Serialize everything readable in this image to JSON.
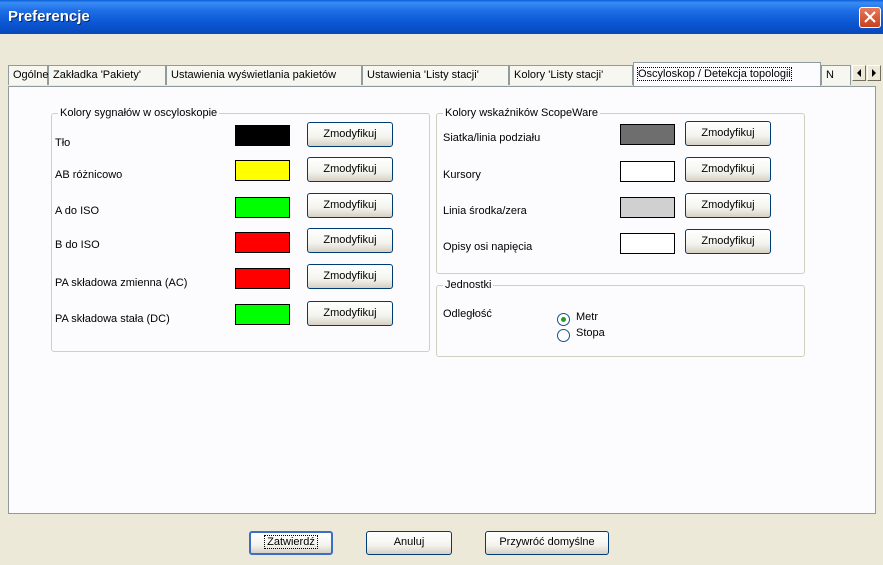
{
  "window": {
    "title": "Preferencje"
  },
  "tabs": [
    {
      "label": "Ogólne"
    },
    {
      "label": "Zakładka 'Pakiety'"
    },
    {
      "label": "Ustawienia wyświetlania pakietów"
    },
    {
      "label": "Ustawienia 'Listy stacji'"
    },
    {
      "label": "Kolory 'Listy stacji'"
    },
    {
      "label": "Oscyloskop / Detekcja topologii"
    },
    {
      "label": "N"
    }
  ],
  "active_tab": "Oscyloskop / Detekcja topologii",
  "signal_colors": {
    "title": "Kolory sygnałów w oscyloskopie",
    "rows": [
      {
        "label": "Tło",
        "color": "#000000",
        "button": "Zmodyfikuj"
      },
      {
        "label": "AB różnicowo",
        "color": "#ffff00",
        "button": "Zmodyfikuj"
      },
      {
        "label": "A do ISO",
        "color": "#00ff00",
        "button": "Zmodyfikuj"
      },
      {
        "label": "B do ISO",
        "color": "#ff0000",
        "button": "Zmodyfikuj"
      },
      {
        "label": "PA składowa zmienna (AC)",
        "color": "#ff0000",
        "button": "Zmodyfikuj"
      },
      {
        "label": "PA składowa stała (DC)",
        "color": "#00ff00",
        "button": "Zmodyfikuj"
      }
    ]
  },
  "scopeware_colors": {
    "title": "Kolory wskaźników ScopeWare",
    "rows": [
      {
        "label": "Siatka/linia podziału",
        "color": "#6e6e6e",
        "button": "Zmodyfikuj"
      },
      {
        "label": "Kursory",
        "color": "#ffffff",
        "button": "Zmodyfikuj"
      },
      {
        "label": "Linia środka/zera",
        "color": "#d0d0d0",
        "button": "Zmodyfikuj"
      },
      {
        "label": "Opisy osi napięcia",
        "color": "#ffffff",
        "button": "Zmodyfikuj"
      }
    ]
  },
  "units": {
    "title": "Jednostki",
    "distance_label": "Odległość",
    "options": [
      {
        "label": "Metr",
        "checked": true
      },
      {
        "label": "Stopa",
        "checked": false
      }
    ]
  },
  "buttons": {
    "confirm": "Zatwierdź",
    "cancel": "Anuluj",
    "restore": "Przywróć domyślne"
  }
}
